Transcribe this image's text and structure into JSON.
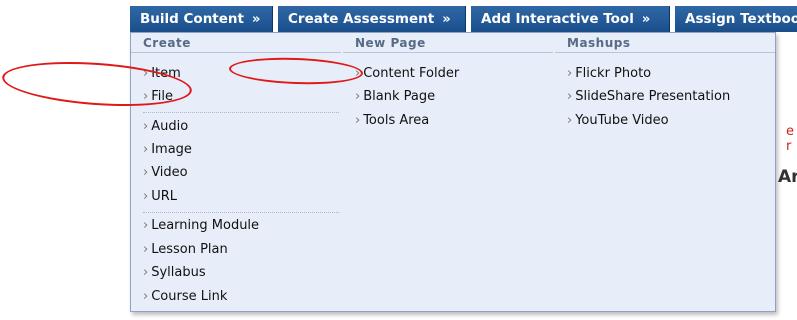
{
  "toolbar": {
    "buttons": [
      {
        "label": "Build Content",
        "chevron": "»"
      },
      {
        "label": "Create Assessment",
        "chevron": "»"
      },
      {
        "label": "Add Interactive Tool",
        "chevron": "»"
      },
      {
        "label": "Assign Textboo"
      }
    ]
  },
  "menu": {
    "columns": [
      {
        "header": "Create",
        "items": [
          "Item",
          "File",
          "Audio",
          "Image",
          "Video",
          "URL",
          "Learning Module",
          "Lesson Plan",
          "Syllabus",
          "Course Link"
        ]
      },
      {
        "header": "New Page",
        "items": [
          "Content Folder",
          "Blank Page",
          "Tools Area"
        ]
      },
      {
        "header": "Mashups",
        "items": [
          "Flickr Photo",
          "SlideShare Presentation",
          "YouTube Video"
        ]
      }
    ],
    "arrow_glyph": "›"
  },
  "background": {
    "red_text": "e r",
    "heading_text": "Ar"
  },
  "colors": {
    "toolbar": "#1f5592",
    "menu_bg": "#e8eef9",
    "annotation": "#e01818"
  }
}
